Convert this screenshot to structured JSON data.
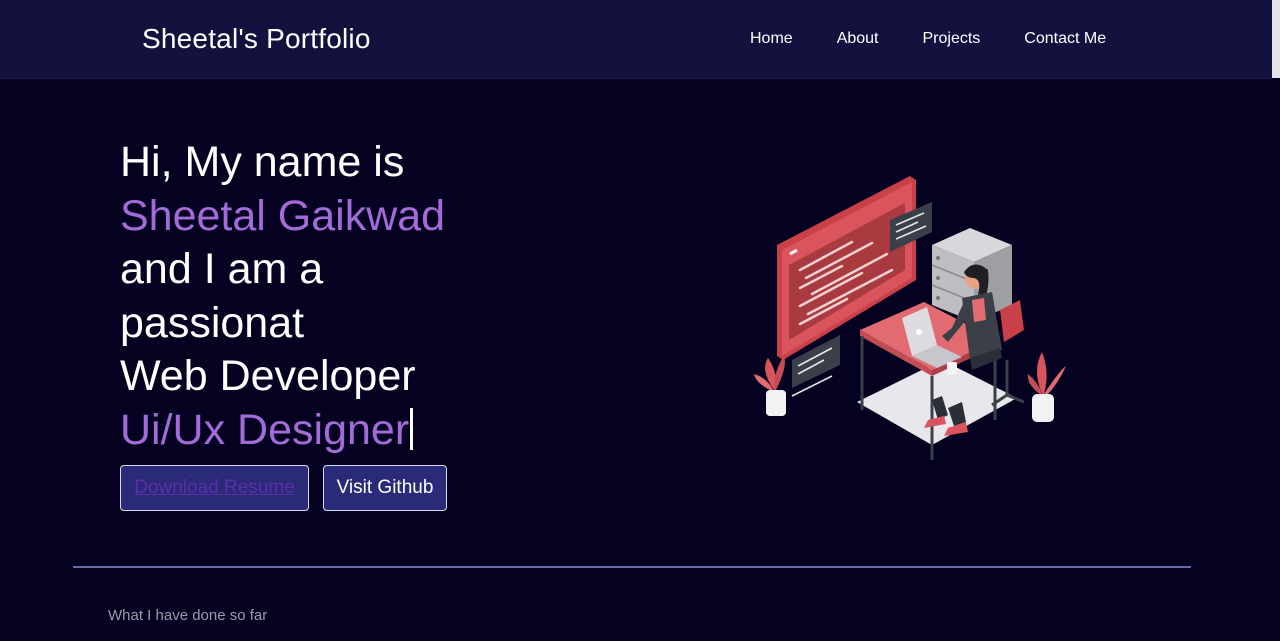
{
  "header": {
    "brand": "Sheetal's Portfolio",
    "nav": [
      {
        "label": "Home"
      },
      {
        "label": "About"
      },
      {
        "label": "Projects"
      },
      {
        "label": "Contact Me"
      }
    ]
  },
  "hero": {
    "line1": "Hi, My name is",
    "name": "Sheetal Gaikwad",
    "line3": "and I am a",
    "line4": "passionat",
    "line5": "Web Developer",
    "line6": "Ui/Ux Designer"
  },
  "buttons": {
    "resume": "Download Resume",
    "github": "Visit Github"
  },
  "section": {
    "subtitle": "What I have done so far"
  },
  "colors": {
    "background": "#040220",
    "navbar": "#13123f",
    "accent": "#a36bd8",
    "button_bg": "#2a2a78",
    "illustration_red": "#d9545c"
  }
}
